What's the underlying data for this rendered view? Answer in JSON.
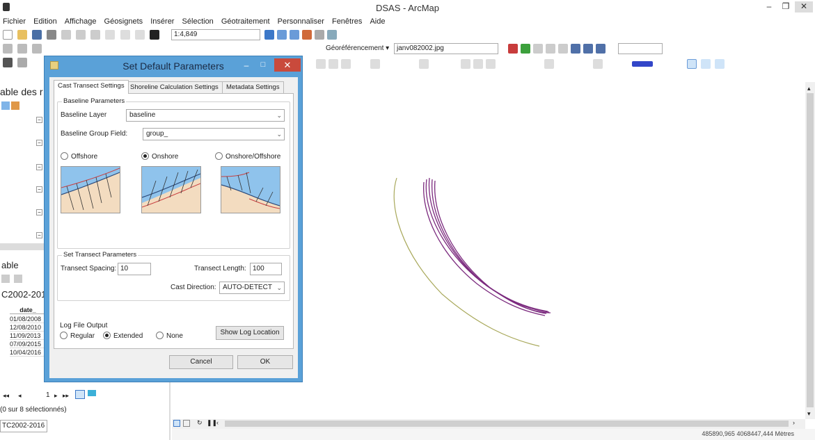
{
  "window": {
    "title": "DSAS - ArcMap",
    "minimize": "–",
    "maximize": "❐",
    "close": "✕"
  },
  "menu": [
    "Fichier",
    "Edition",
    "Affichage",
    "Géosignets",
    "Insérer",
    "Sélection",
    "Géotraitement",
    "Personnaliser",
    "Fenêtres",
    "Aide"
  ],
  "toolbar": {
    "scale": "1:4,849",
    "georef_label": "Géoréférencement ▾",
    "georef_layer": "janv082002.jpg"
  },
  "left_panel": {
    "toc_title": "able des r",
    "table_title": "able",
    "table_name": "C2002-201",
    "column_header": "date_",
    "rows": [
      "01/08/2008",
      "12/08/2010",
      "11/09/2013",
      "07/09/2015",
      "10/04/2016"
    ],
    "nav_record": "1",
    "selection_status": "(0 sur 8 sélectionnés)",
    "bottom_tab": "TC2002-2016"
  },
  "dialog": {
    "title": "Set Default Parameters",
    "minimize": "–",
    "maximize": "□",
    "close": "✕",
    "tabs": [
      "Cast Transect Settings",
      "Shoreline Calculation Settings",
      "Metadata Settings"
    ],
    "baseline_group": "Baseline Parameters",
    "baseline_layer_label": "Baseline Layer",
    "baseline_layer_value": "baseline",
    "baseline_group_field_label": "Baseline Group Field:",
    "baseline_group_field_value": "group_",
    "options": [
      {
        "label": "Offshore",
        "selected": false
      },
      {
        "label": "Onshore",
        "selected": true
      },
      {
        "label": "Onshore/Offshore",
        "selected": false
      }
    ],
    "transect_group": "Set Transect Parameters",
    "spacing_label": "Transect Spacing:",
    "spacing_value": "10",
    "length_label": "Transect Length:",
    "length_value": "100",
    "cast_direction_label": "Cast Direction:",
    "cast_direction_value": "AUTO-DETECT",
    "log_group": "Log File Output",
    "log_options": [
      {
        "label": "Regular",
        "selected": false
      },
      {
        "label": "Extended",
        "selected": true
      },
      {
        "label": "None",
        "selected": false
      }
    ],
    "show_log_button": "Show Log Location",
    "cancel_button": "Cancel",
    "ok_button": "OK"
  },
  "status": {
    "coordinates": "485890,965 4068447,444 Mètres"
  },
  "colors": {
    "dialog_frame": "#5aa1d8",
    "close_red": "#c94a3c",
    "shoreline_purple": "#7b2a7e",
    "baseline_olive": "#a8a85a",
    "water_blue": "#8fc3ec",
    "sand": "#f3dcc0"
  }
}
